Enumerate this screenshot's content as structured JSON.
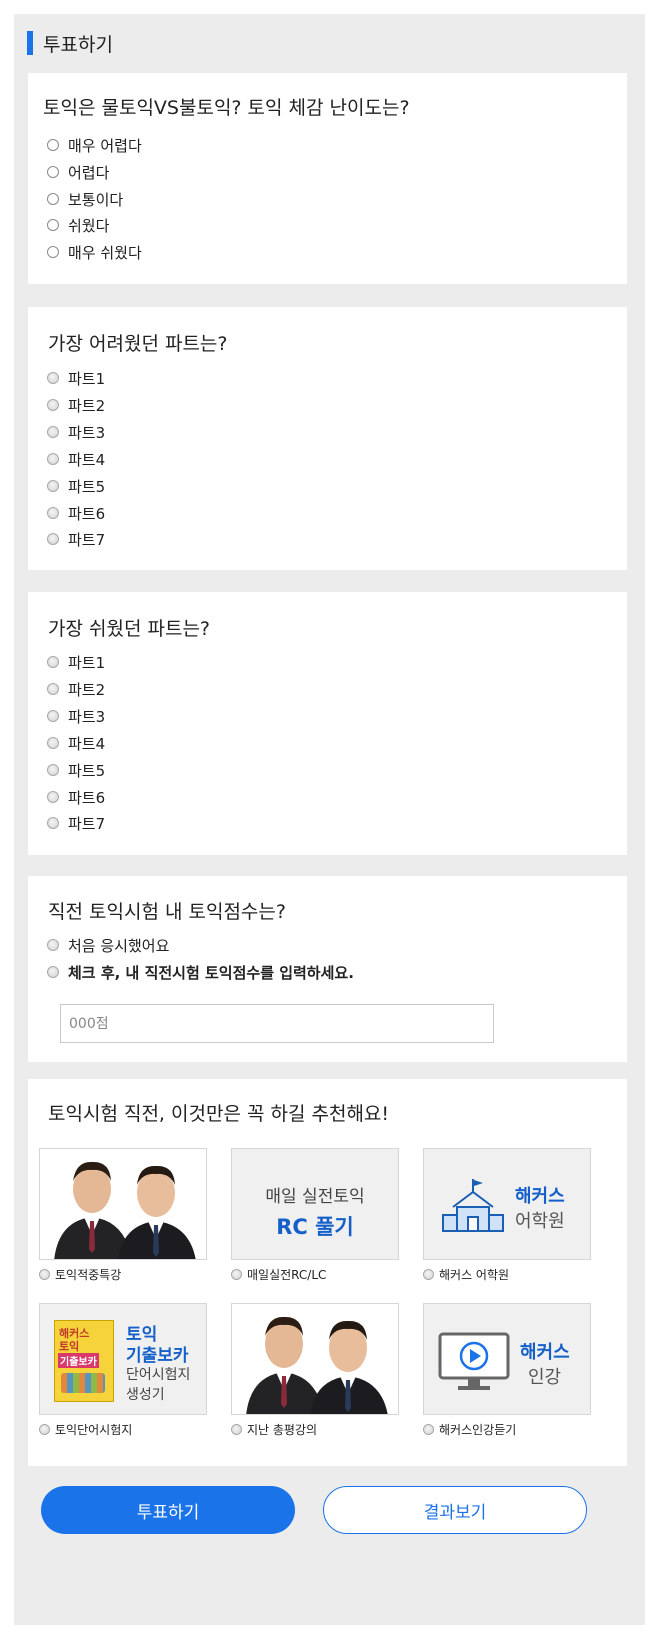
{
  "heading": "투표하기",
  "q1": {
    "title": "토익은 물토익VS불토익? 토익 체감 난이도는?",
    "options": [
      "매우 어렵다",
      "어렵다",
      "보통이다",
      "쉬웠다",
      "매우 쉬웠다"
    ]
  },
  "q2": {
    "title": "가장 어려웠던 파트는?",
    "options": [
      "파트1",
      "파트2",
      "파트3",
      "파트4",
      "파트5",
      "파트6",
      "파트7"
    ]
  },
  "q3": {
    "title": "가장 쉬웠던 파트는?",
    "options": [
      "파트1",
      "파트2",
      "파트3",
      "파트4",
      "파트5",
      "파트6",
      "파트7"
    ]
  },
  "q4": {
    "title": "직전 토익시험 내 토익점수는?",
    "options": [
      "처음 응시했어요",
      "체크 후, 내 직전시험 토익점수를 입력하세요."
    ],
    "score_placeholder": "000점"
  },
  "q5": {
    "title": "토익시험 직전, 이것만은 꼭 하길 추천해요!",
    "items": [
      {
        "caption": "토익적중특강",
        "thumb": "teachers-photo"
      },
      {
        "caption": "매일실전RC/LC",
        "thumb": "rc-banner",
        "line1": "매일 실전토익",
        "line2": "RC 풀기"
      },
      {
        "caption": "해커스 어학원",
        "thumb": "academy-banner",
        "line1": "해커스",
        "line2": "어학원"
      },
      {
        "caption": "토익단어시험지",
        "thumb": "book-banner",
        "book1": "해커스",
        "book2": "토익",
        "book3": "기출보카",
        "line1": "토익",
        "line2": "기출보카",
        "line3": "단어시험지",
        "line4": "생성기"
      },
      {
        "caption": "지난 총평강의",
        "thumb": "teachers-photo"
      },
      {
        "caption": "해커스인강듣기",
        "thumb": "lecture-banner",
        "line1": "해커스",
        "line2": "인강"
      }
    ]
  },
  "buttons": {
    "vote": "투표하기",
    "results": "결과보기"
  },
  "colors": {
    "accent": "#1a73e8",
    "background": "#ececec",
    "card": "#ffffff"
  }
}
